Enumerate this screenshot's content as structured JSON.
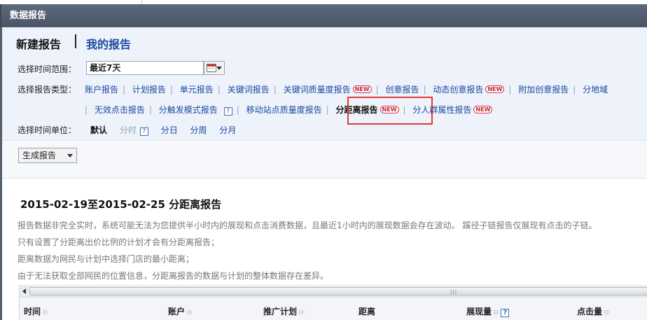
{
  "window": {
    "title": "数据报告"
  },
  "tabs": {
    "new_report": "新建报告",
    "my_reports": "我的报告"
  },
  "time_range": {
    "label": "选择时间范围：",
    "value": "最近7天"
  },
  "report_type": {
    "label": "选择报告类型：",
    "row1": [
      {
        "label": "账户报告"
      },
      {
        "label": "计划报告"
      },
      {
        "label": "单元报告"
      },
      {
        "label": "关键词报告"
      },
      {
        "label": "关键词质量度报告",
        "badge": "NEW"
      },
      {
        "label": "创意报告"
      },
      {
        "label": "动态创意报告",
        "badge": "NEW"
      },
      {
        "label": "附加创意报告"
      },
      {
        "label": "分地域"
      }
    ],
    "row2": [
      {
        "label": "无效点击报告"
      },
      {
        "label": "分触发模式报告",
        "help": "?"
      },
      {
        "label": "移动站点质量度报告"
      },
      {
        "label": "分距离报告",
        "badge": "NEW",
        "selected": true
      },
      {
        "label": "分人群属性报告",
        "badge": "NEW"
      }
    ]
  },
  "time_unit": {
    "label": "选择时间单位：",
    "default": "默认",
    "hour": "分时",
    "help": "?",
    "day": "分日",
    "week": "分周",
    "month": "分月"
  },
  "generate": {
    "label": "生成报告"
  },
  "report": {
    "title": "2015-02-19至2015-02-25 分距离报告",
    "notes": [
      "报告数据非完全实时，系统可能无法为您提供半小时内的展现和点击消费数据，且最近1小时内的展现数据会存在波动。 蹊径子链报告仅展现有点击的子链。",
      "只有设置了分距离出价比例的计划才会有分距离报告；",
      "距离数据为网民与计划中选择门店的最小距离；",
      "由于无法获取全部网民的位置信息，分距离报告的数据与计划的整体数据存在差异。"
    ]
  },
  "table": {
    "columns": [
      "时间",
      "账户",
      "推广计划",
      "距离",
      "展现量",
      "点击量"
    ],
    "help": "?"
  },
  "colors": {
    "accent": "#1a4aa0",
    "highlight": "#e23a3a",
    "title_bar": "#4a5566"
  }
}
